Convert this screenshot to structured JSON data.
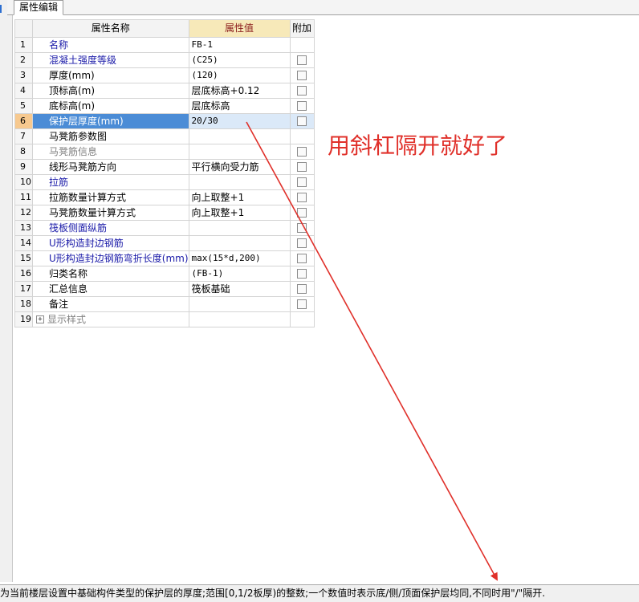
{
  "tab": {
    "label": "属性编辑"
  },
  "columns": {
    "name": "属性名称",
    "value": "属性值",
    "extra": "附加"
  },
  "rows": [
    {
      "num": "1",
      "name": "名称",
      "value": "FB-1",
      "checkbox": false,
      "style": "blue",
      "cjk": false
    },
    {
      "num": "2",
      "name": "混凝土强度等级",
      "value": "(C25)",
      "checkbox": true,
      "style": "blue",
      "cjk": false
    },
    {
      "num": "3",
      "name": "厚度(mm)",
      "value": "(120)",
      "checkbox": true,
      "style": "normal",
      "cjk": false
    },
    {
      "num": "4",
      "name": "顶标高(m)",
      "value": "层底标高+0.12",
      "checkbox": true,
      "style": "normal",
      "cjk": true
    },
    {
      "num": "5",
      "name": "底标高(m)",
      "value": "层底标高",
      "checkbox": true,
      "style": "normal",
      "cjk": true
    },
    {
      "num": "6",
      "name": "保护层厚度(mm)",
      "value": "20/30",
      "checkbox": true,
      "style": "blue",
      "cjk": false,
      "selected": true
    },
    {
      "num": "7",
      "name": "马凳筋参数图",
      "value": "",
      "checkbox": false,
      "style": "normal",
      "cjk": false
    },
    {
      "num": "8",
      "name": "马凳筋信息",
      "value": "",
      "checkbox": true,
      "style": "gray",
      "cjk": false
    },
    {
      "num": "9",
      "name": "线形马凳筋方向",
      "value": "平行横向受力筋",
      "checkbox": true,
      "style": "normal",
      "cjk": true
    },
    {
      "num": "10",
      "name": "拉筋",
      "value": "",
      "checkbox": true,
      "style": "blue",
      "cjk": false
    },
    {
      "num": "11",
      "name": "拉筋数量计算方式",
      "value": "向上取整+1",
      "checkbox": true,
      "style": "normal",
      "cjk": true
    },
    {
      "num": "12",
      "name": "马凳筋数量计算方式",
      "value": "向上取整+1",
      "checkbox": true,
      "style": "normal",
      "cjk": true
    },
    {
      "num": "13",
      "name": "筏板侧面纵筋",
      "value": "",
      "checkbox": true,
      "style": "blue",
      "cjk": false
    },
    {
      "num": "14",
      "name": "U形构造封边钢筋",
      "value": "",
      "checkbox": true,
      "style": "blue",
      "cjk": false
    },
    {
      "num": "15",
      "name": "U形构造封边钢筋弯折长度(mm)",
      "value": "max(15*d,200)",
      "checkbox": true,
      "style": "blue",
      "cjk": false
    },
    {
      "num": "16",
      "name": "归类名称",
      "value": "(FB-1)",
      "checkbox": true,
      "style": "normal",
      "cjk": false
    },
    {
      "num": "17",
      "name": "汇总信息",
      "value": "筏板基础",
      "checkbox": true,
      "style": "normal",
      "cjk": true
    },
    {
      "num": "18",
      "name": "备注",
      "value": "",
      "checkbox": true,
      "style": "normal",
      "cjk": false
    },
    {
      "num": "19",
      "name": "显示样式",
      "value": "",
      "checkbox": false,
      "style": "expand",
      "cjk": false
    }
  ],
  "annotation": {
    "text": "用斜杠隔开就好了",
    "color": "#e0302a"
  },
  "statusbar": {
    "text": "为当前楼层设置中基础构件类型的保护层的厚度;范围[0,1/2板厚)的整数;一个数值时表示底/侧/顶面保护层均同,不同时用\"/\"隔开."
  },
  "icons": {
    "expander": "plus-box-icon",
    "checkbox": "checkbox-icon"
  },
  "colors": {
    "selected_row": "#4b8cd6",
    "header_value_bg": "#f7e9b9",
    "active_num_bg": "#f7c98f",
    "link_text": "#1a1aa8"
  }
}
